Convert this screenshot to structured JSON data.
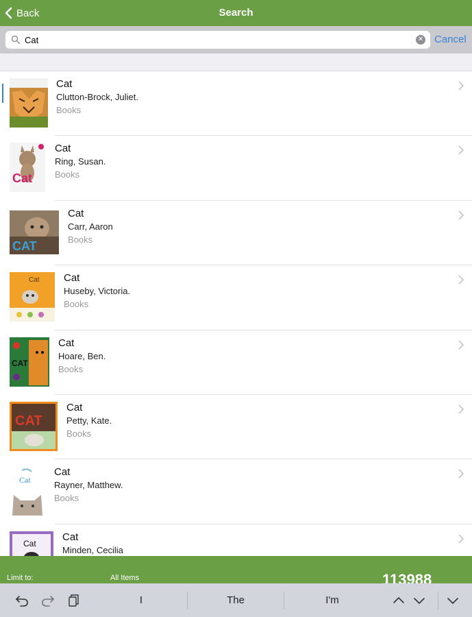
{
  "nav": {
    "back_label": "Back",
    "title": "Search"
  },
  "search": {
    "value": "Cat",
    "cancel_label": "Cancel"
  },
  "results": [
    {
      "title": "Cat",
      "author": "Clutton-Brock, Juliet.",
      "type": "Books"
    },
    {
      "title": "Cat",
      "author": "Ring, Susan.",
      "type": "Books"
    },
    {
      "title": "Cat",
      "author": "Carr, Aaron",
      "type": "Books"
    },
    {
      "title": "Cat",
      "author": "Huseby, Victoria.",
      "type": "Books"
    },
    {
      "title": "Cat",
      "author": "Hoare, Ben.",
      "type": "Books"
    },
    {
      "title": "Cat",
      "author": "Petty, Kate.",
      "type": "Books"
    },
    {
      "title": "Cat",
      "author": "Rayner, Matthew.",
      "type": "Books"
    },
    {
      "title": "Cat",
      "author": "Minden, Cecilia",
      "type": ""
    }
  ],
  "footer": {
    "limit_label": "Limit to:",
    "limit_value": "All Items",
    "count": "113988"
  },
  "keyboard": {
    "suggestions": [
      "I",
      "The",
      "I'm"
    ]
  },
  "colors": {
    "brand_green": "#6a9f46",
    "link_blue": "#3b82d6"
  }
}
